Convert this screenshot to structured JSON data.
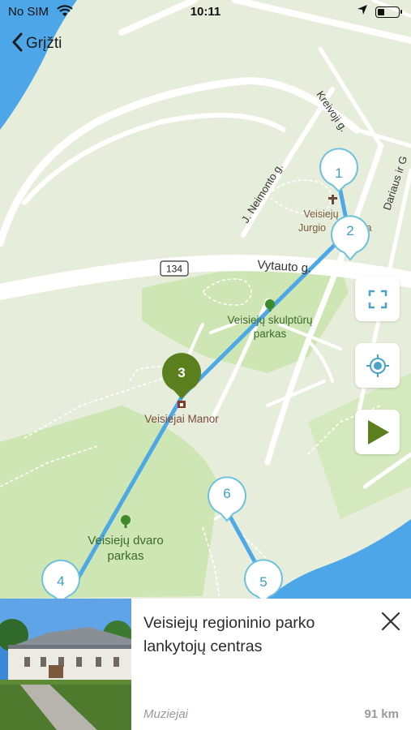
{
  "status_bar": {
    "carrier": "No SIM",
    "time": "10:11"
  },
  "nav": {
    "back_label": "Grįžti"
  },
  "map": {
    "roads": [
      {
        "label": "Kreivoji g."
      },
      {
        "label": "J. Neimonto g."
      },
      {
        "label": "Dariaus ir G"
      },
      {
        "label": "Vytauto g."
      }
    ],
    "route_shield": "134",
    "places": [
      {
        "label": "Veisiejų"
      },
      {
        "label": "Jurgio"
      },
      {
        "label": "a"
      },
      {
        "label": "Veisiejų skulptūrų"
      },
      {
        "label": "parkas"
      },
      {
        "label": "Veisiejai Manor"
      },
      {
        "label": "Veisiejų dvaro"
      },
      {
        "label": "parkas"
      }
    ],
    "stops": [
      {
        "number": "1"
      },
      {
        "number": "2"
      },
      {
        "number": "3"
      },
      {
        "number": "4"
      },
      {
        "number": "5"
      },
      {
        "number": "6"
      }
    ],
    "colors": {
      "water": "#4da6e8",
      "land": "#e6eedb",
      "park": "#cde6b3",
      "route": "#4ea8e6",
      "active_pin": "#5c7f1e",
      "pin_text": "#3d9ec7"
    }
  },
  "controls": {
    "fullscreen_icon": "fullscreen-icon",
    "locate_icon": "crosshair-icon",
    "play_icon": "play-icon"
  },
  "card": {
    "title": "Veisiejų regioninio parko lankytojų centras",
    "category": "Muziejai",
    "distance": "91 km"
  }
}
